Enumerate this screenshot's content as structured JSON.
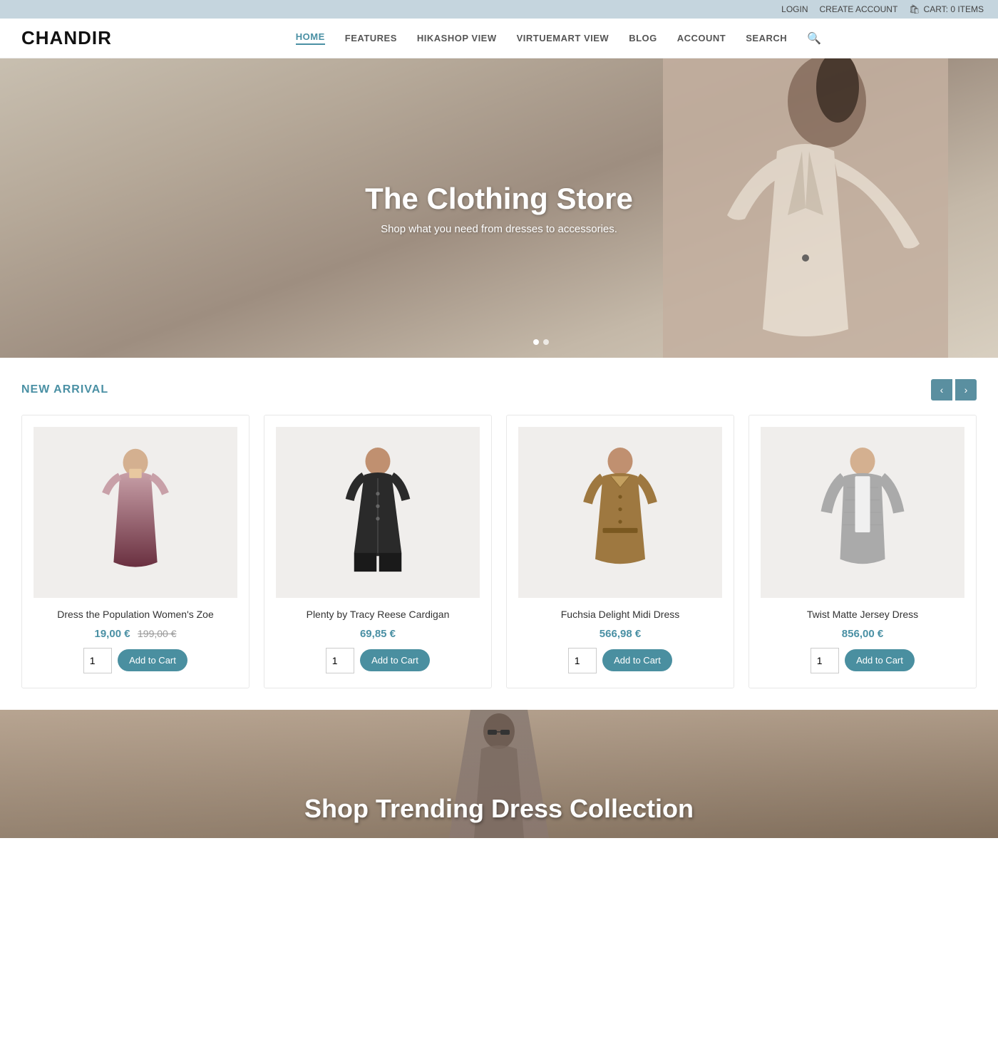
{
  "topbar": {
    "login": "LOGIN",
    "create_account": "CREATE ACCOUNT",
    "cart": "CART: 0 ITEMS"
  },
  "header": {
    "logo": "CHANDIR",
    "nav": [
      {
        "label": "HOME",
        "active": true
      },
      {
        "label": "FEATURES",
        "active": false
      },
      {
        "label": "HIKASHOP VIEW",
        "active": false
      },
      {
        "label": "VIRTUEMART VIEW",
        "active": false
      },
      {
        "label": "BLOG",
        "active": false
      },
      {
        "label": "ACCOUNT",
        "active": false
      },
      {
        "label": "SEARCH",
        "active": false
      }
    ]
  },
  "hero": {
    "title": "The Clothing Store",
    "subtitle": "Shop what you need from dresses to accessories."
  },
  "new_arrival": {
    "section_title": "NEW ARRIVAL",
    "prev_label": "‹",
    "next_label": "›",
    "products": [
      {
        "name": "Dress the Population Women's Zoe",
        "price": "19,00 €",
        "original_price": "199,00 €",
        "qty": "1",
        "btn_label": "Add to Cart",
        "color1": "#c0607080",
        "color2": "#806070"
      },
      {
        "name": "Plenty by Tracy Reese Cardigan",
        "price": "69,85 €",
        "original_price": "",
        "qty": "1",
        "btn_label": "Add to Cart",
        "color1": "#333333",
        "color2": "#222222"
      },
      {
        "name": "Fuchsia Delight Midi Dress",
        "price": "566,98 €",
        "original_price": "",
        "qty": "1",
        "btn_label": "Add to Cart",
        "color1": "#8B6A40",
        "color2": "#6B4A20"
      },
      {
        "name": "Twist Matte Jersey Dress",
        "price": "856,00 €",
        "original_price": "",
        "qty": "1",
        "btn_label": "Add to Cart",
        "color1": "#999999",
        "color2": "#777777"
      }
    ]
  },
  "bottom_banner": {
    "title": "Shop Trending Dress Collection"
  }
}
